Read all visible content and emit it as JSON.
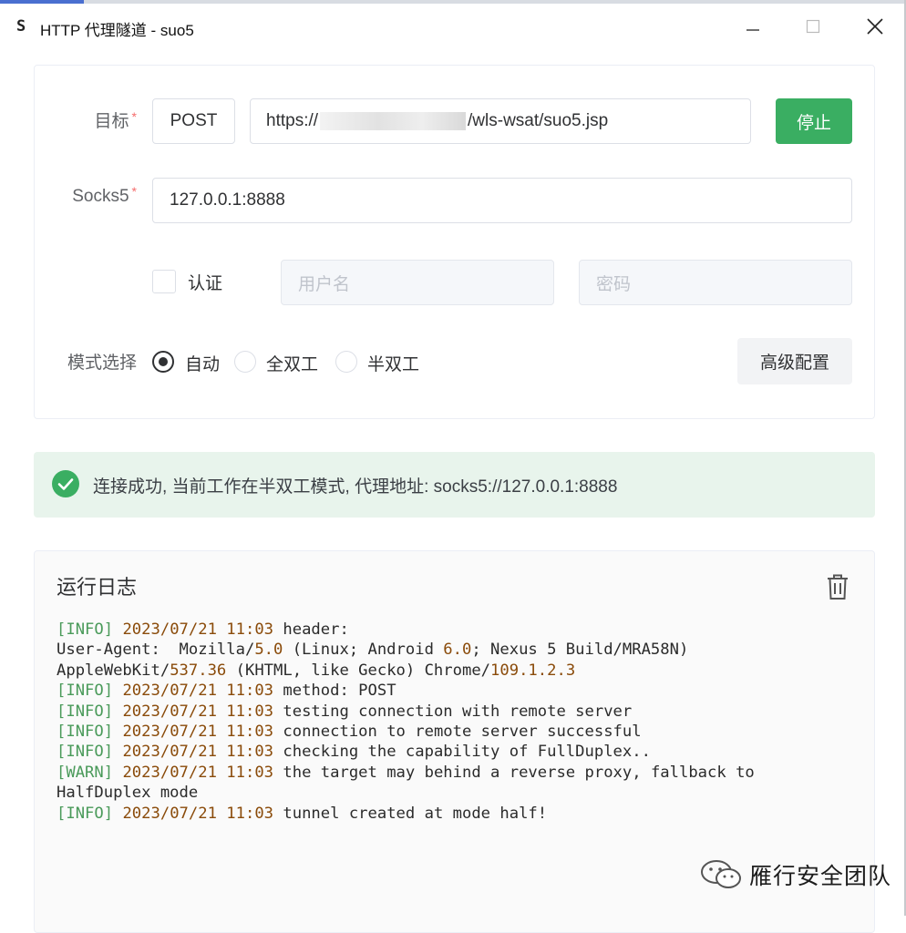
{
  "window": {
    "title": "HTTP 代理隧道 - suo5",
    "app_icon": "S",
    "controls": [
      "minimize",
      "maximize",
      "close"
    ]
  },
  "form": {
    "target_label": "目标",
    "method": "POST",
    "url_prefix": "https://",
    "url_suffix": "/wls-wsat/suo5.jsp",
    "stop_button": "停止",
    "socks5_label": "Socks5",
    "socks5_value": "127.0.0.1:8888",
    "required_mark": "*",
    "auth_label": "认证",
    "auth_checked": false,
    "username_placeholder": "用户名",
    "password_placeholder": "密码",
    "mode_label": "模式选择",
    "modes": [
      {
        "label": "自动",
        "checked": true
      },
      {
        "label": "全双工",
        "checked": false
      },
      {
        "label": "半双工",
        "checked": false
      }
    ],
    "advanced_button": "高级配置"
  },
  "alert": {
    "text": "连接成功, 当前工作在半双工模式, 代理地址: socks5://127.0.0.1:8888",
    "color": "#3aae62"
  },
  "log": {
    "title": "运行日志",
    "lines": [
      "[INFO] 2023/07/21 11:03 header:",
      "User-Agent:  Mozilla/5.0 (Linux; Android 6.0; Nexus 5 Build/MRA58N)",
      "AppleWebKit/537.36 (KHTML, like Gecko) Chrome/109.1.2.3",
      "[INFO] 2023/07/21 11:03 method: POST",
      "[INFO] 2023/07/21 11:03 testing connection with remote server",
      "[INFO] 2023/07/21 11:03 connection to remote server successful",
      "[INFO] 2023/07/21 11:03 checking the capability of FullDuplex..",
      "[WARN] 2023/07/21 11:03 the target may behind a reverse proxy, fallback to",
      "HalfDuplex mode",
      "[INFO] 2023/07/21 11:03 tunnel created at mode half!"
    ]
  },
  "watermark": {
    "text": "雁行安全团队"
  }
}
